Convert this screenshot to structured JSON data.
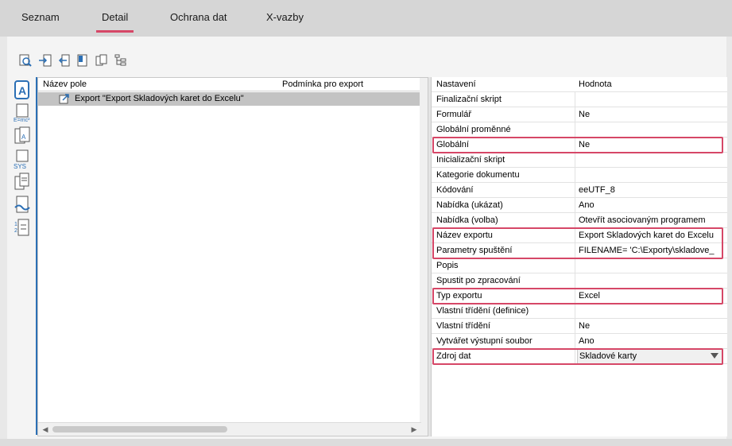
{
  "tabs": [
    {
      "label": "Seznam",
      "active": false
    },
    {
      "label": "Detail",
      "active": true
    },
    {
      "label": "Ochrana dat",
      "active": false
    },
    {
      "label": "X-vazby",
      "active": false
    }
  ],
  "toolbar_icons": [
    "find-icon",
    "insert-field-icon",
    "remove-field-icon",
    "bookmark-icon",
    "copy-icon",
    "tree-icon"
  ],
  "sidebar_icons": [
    "text-field-icon",
    "formula-icon",
    "label-icon",
    "system-variable-icon",
    "copy-document-icon",
    "link-document-icon",
    "sort-icon"
  ],
  "left_grid": {
    "col1": "Název pole",
    "col2": "Podmínka pro export",
    "row": "Export \"Export Skladových karet do Excelu\""
  },
  "right_grid": {
    "header_key": "Nastavení",
    "header_value": "Hodnota",
    "rows": [
      {
        "k": "Finalizační skript",
        "v": ""
      },
      {
        "k": "Formulář",
        "v": "Ne"
      },
      {
        "k": "Globální proměnné",
        "v": ""
      },
      {
        "k": "Globální",
        "v": "Ne"
      },
      {
        "k": "Inicializační skript",
        "v": ""
      },
      {
        "k": "Kategorie dokumentu",
        "v": ""
      },
      {
        "k": "Kódování",
        "v": "eeUTF_8"
      },
      {
        "k": "Nabídka (ukázat)",
        "v": "Ano"
      },
      {
        "k": "Nabídka (volba)",
        "v": "Otevřít asociovaným programem"
      },
      {
        "k": "Název exportu",
        "v": "Export Skladových karet do Excelu"
      },
      {
        "k": "Parametry spuštění",
        "v": "FILENAME=  'C:\\Exporty\\skladove_"
      },
      {
        "k": "Popis",
        "v": ""
      },
      {
        "k": "Spustit po zpracování",
        "v": ""
      },
      {
        "k": "Typ exportu",
        "v": "Excel"
      },
      {
        "k": "Vlastní třídění (definice)",
        "v": ""
      },
      {
        "k": "Vlastní třídění",
        "v": "Ne"
      },
      {
        "k": "Vytvářet výstupní soubor",
        "v": "Ano"
      },
      {
        "k": "Zdroj dat",
        "v": "Skladové karty"
      }
    ]
  },
  "accent_color": "#d64767"
}
